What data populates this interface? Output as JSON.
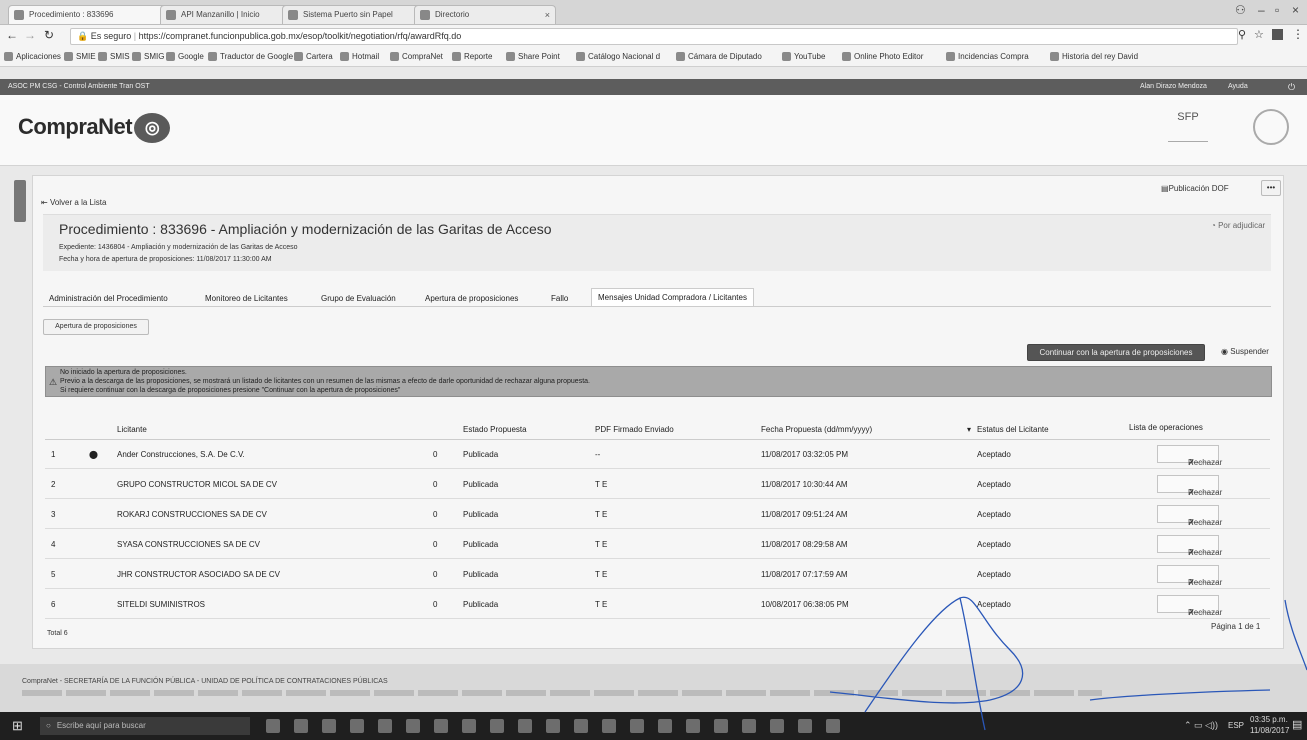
{
  "browser": {
    "tabs": [
      {
        "label": "Procedimiento : 833696"
      },
      {
        "label": "API Manzanillo | Inicio"
      },
      {
        "label": "Sistema Puerto sin Papel"
      },
      {
        "label": "Directorio"
      }
    ],
    "secure_label": "Es seguro",
    "url": "https://compranet.funcionpublica.gob.mx/esop/toolkit/negotiation/rfq/awardRfq.do",
    "bookmarks": [
      "Aplicaciones",
      "SMIE",
      "SMIS",
      "SMIG",
      "Google",
      "Traductor de Google",
      "Cartera",
      "Hotmail",
      "CompraNet",
      "Reporte",
      "Share Point",
      "Catálogo Nacional d",
      "Cámara de Diputado",
      "YouTube",
      "Online Photo Editor",
      "Incidencias Compra",
      "Historia del rey David"
    ]
  },
  "app": {
    "top_left": "ASOC PM CSG - Control Ambiente Tran OST",
    "user": "Alan Dirazo Mendoza",
    "help": "Ayuda",
    "logo": "CompraNet",
    "seal": "SFP"
  },
  "page": {
    "back_link": "Volver a la Lista",
    "publication_dof": "Publicación DOF",
    "more": "•••",
    "title": "Procedimiento : 833696 - Ampliación y modernización de las Garitas de Acceso",
    "expediente": "Expediente: 1436804 - Ampliación y modernización de las Garitas de Acceso",
    "fecha": "Fecha y hora de apertura de proposiciones: 11/08/2017 11:30:00 AM",
    "por_adjudicar": "Por adjudicar",
    "tabs": [
      "Administración del Procedimiento",
      "Monitoreo de Licitantes",
      "Grupo de Evaluación",
      "Apertura de proposiciones",
      "Fallo",
      "Mensajes Unidad Compradora / Licitantes"
    ],
    "subtab": "Apertura de proposiciones",
    "continue_button": "Continuar con la apertura de proposiciones",
    "suspend": "Suspender",
    "notice": [
      "No iniciado la apertura de proposiciones.",
      "Previo a la descarga de las proposiciones, se mostrará un listado de licitantes con un resumen de las mismas a efecto de darle oportunidad de rechazar alguna propuesta.",
      "Si requiere continuar con la descarga de proposiciones presione \"Continuar con la apertura de proposiciones\""
    ],
    "columns": [
      "Licitante",
      "Estado Propuesta",
      "PDF Firmado Enviado",
      "Fecha Propuesta (dd/mm/yyyy)",
      "Estatus del Licitante",
      "Lista de operaciones"
    ],
    "rows": [
      {
        "n": "1",
        "name": "Ander Construcciones, S.A. De C.V.",
        "zero": "0",
        "estado": "Publicada",
        "pdf": "--",
        "fecha": "11/08/2017 03:32:05 PM",
        "estatus": "Aceptado",
        "op": "Rechazar"
      },
      {
        "n": "2",
        "name": "GRUPO CONSTRUCTOR MICOL SA DE CV",
        "zero": "0",
        "estado": "Publicada",
        "pdf": "T E",
        "fecha": "11/08/2017 10:30:44 AM",
        "estatus": "Aceptado",
        "op": "Rechazar"
      },
      {
        "n": "3",
        "name": "ROKARJ CONSTRUCCIONES SA DE CV",
        "zero": "0",
        "estado": "Publicada",
        "pdf": "T E",
        "fecha": "11/08/2017 09:51:24 AM",
        "estatus": "Aceptado",
        "op": "Rechazar"
      },
      {
        "n": "4",
        "name": "SYASA CONSTRUCCIONES SA DE CV",
        "zero": "0",
        "estado": "Publicada",
        "pdf": "T E",
        "fecha": "11/08/2017 08:29:58 AM",
        "estatus": "Aceptado",
        "op": "Rechazar"
      },
      {
        "n": "5",
        "name": "JHR CONSTRUCTOR ASOCIADO SA DE CV",
        "zero": "0",
        "estado": "Publicada",
        "pdf": "T E",
        "fecha": "11/08/2017 07:17:59 AM",
        "estatus": "Aceptado",
        "op": "Rechazar"
      },
      {
        "n": "6",
        "name": "SITELDI SUMINISTROS",
        "zero": "0",
        "estado": "Publicada",
        "pdf": "T E",
        "fecha": "10/08/2017 06:38:05 PM",
        "estatus": "Aceptado",
        "op": "Rechazar"
      }
    ],
    "total": "Total 6",
    "pagination": "Página 1 de 1"
  },
  "footer": {
    "line1": "CompraNet - SECRETARÍA DE LA FUNCIÓN PÚBLICA - UNIDAD DE POLÍTICA DE CONTRATACIONES PÚBLICAS"
  },
  "taskbar": {
    "search": "Escribe aquí para buscar",
    "lang": "ESP",
    "time": "03:35 p.m.",
    "date": "11/08/2017"
  }
}
